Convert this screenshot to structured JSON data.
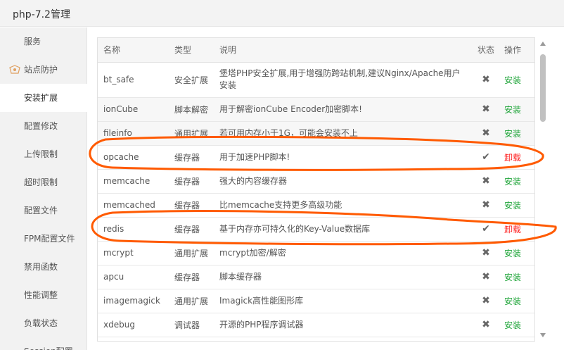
{
  "window": {
    "title": "php-7.2管理"
  },
  "sidebar": {
    "items": [
      {
        "label": "服务"
      },
      {
        "label": "站点防护"
      },
      {
        "label": "安装扩展"
      },
      {
        "label": "配置修改"
      },
      {
        "label": "上传限制"
      },
      {
        "label": "超时限制"
      },
      {
        "label": "配置文件"
      },
      {
        "label": "FPM配置文件"
      },
      {
        "label": "禁用函数"
      },
      {
        "label": "性能调整"
      },
      {
        "label": "负载状态"
      },
      {
        "label": "Session配置"
      }
    ],
    "active_index": 2
  },
  "table": {
    "headers": {
      "name": "名称",
      "type": "类型",
      "desc": "说明",
      "status": "状态",
      "action": "操作"
    },
    "rows": [
      {
        "name": "bt_safe",
        "type": "安全扩展",
        "desc": "堡塔PHP安全扩展,用于增强防跨站机制,建议Nginx/Apache用户安装",
        "status": "✖",
        "action": "安装",
        "installed": false
      },
      {
        "name": "ionCube",
        "type": "脚本解密",
        "desc": "用于解密ionCube Encoder加密脚本!",
        "status": "✖",
        "action": "安装",
        "installed": false
      },
      {
        "name": "fileinfo",
        "type": "通用扩展",
        "desc": "若可用内存小于1G，可能会安装不上",
        "status": "✖",
        "action": "安装",
        "installed": false
      },
      {
        "name": "opcache",
        "type": "缓存器",
        "desc": "用于加速PHP脚本!",
        "status": "✔",
        "action": "卸载",
        "installed": true
      },
      {
        "name": "memcache",
        "type": "缓存器",
        "desc": "强大的内容缓存器",
        "status": "✖",
        "action": "安装",
        "installed": false
      },
      {
        "name": "memcached",
        "type": "缓存器",
        "desc": "比memcache支持更多高级功能",
        "status": "✖",
        "action": "安装",
        "installed": false
      },
      {
        "name": "redis",
        "type": "缓存器",
        "desc": "基于内存亦可持久化的Key-Value数据库",
        "status": "✔",
        "action": "卸载",
        "installed": true
      },
      {
        "name": "mcrypt",
        "type": "通用扩展",
        "desc": "mcrypt加密/解密",
        "status": "✖",
        "action": "安装",
        "installed": false
      },
      {
        "name": "apcu",
        "type": "缓存器",
        "desc": "脚本缓存器",
        "status": "✖",
        "action": "安装",
        "installed": false
      },
      {
        "name": "imagemagick",
        "type": "通用扩展",
        "desc": "Imagick高性能图形库",
        "status": "✖",
        "action": "安装",
        "installed": false
      },
      {
        "name": "xdebug",
        "type": "调试器",
        "desc": "开源的PHP程序调试器",
        "status": "✖",
        "action": "安装",
        "installed": false
      }
    ]
  },
  "colors": {
    "install": "#20a53a",
    "uninstall": "#ff1e1e",
    "annotation": "#ff5a00"
  }
}
